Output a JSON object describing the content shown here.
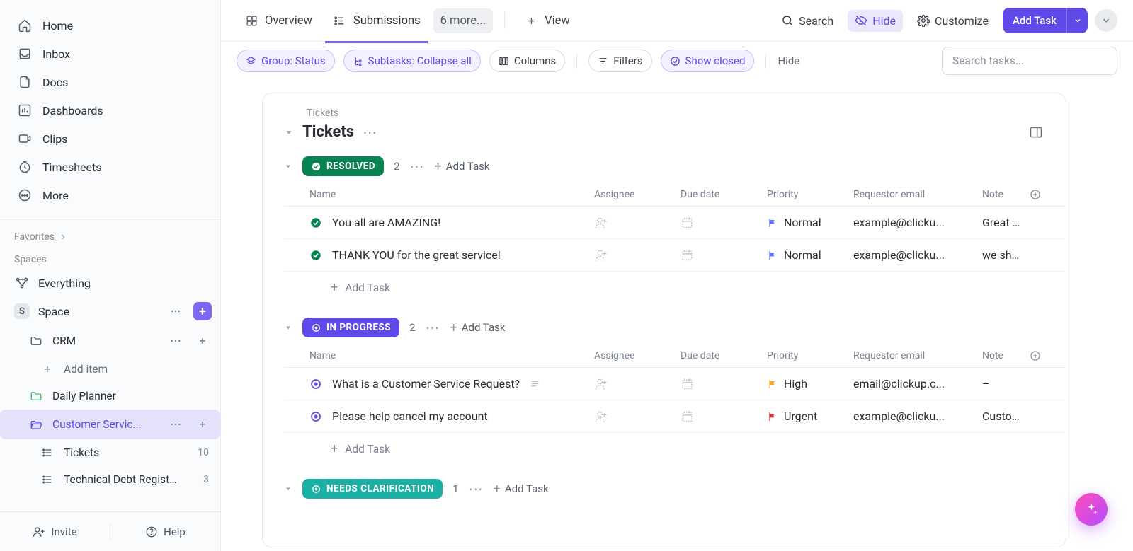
{
  "sidebar": {
    "nav": [
      {
        "label": "Home",
        "icon": "home"
      },
      {
        "label": "Inbox",
        "icon": "inbox"
      },
      {
        "label": "Docs",
        "icon": "doc"
      },
      {
        "label": "Dashboards",
        "icon": "dash"
      },
      {
        "label": "Clips",
        "icon": "clip"
      },
      {
        "label": "Timesheets",
        "icon": "time"
      },
      {
        "label": "More",
        "icon": "more"
      }
    ],
    "favorites_label": "Favorites",
    "spaces_label": "Spaces",
    "everything_label": "Everything",
    "space_label": "Space",
    "space_initial": "S",
    "tree": [
      {
        "label": "CRM",
        "type": "folder"
      },
      {
        "label": "Add item",
        "type": "add"
      },
      {
        "label": "Daily Planner",
        "type": "folder-green"
      },
      {
        "label": "Customer Servic...",
        "type": "folder-active"
      },
      {
        "label": "Tickets",
        "type": "list",
        "count": "10"
      },
      {
        "label": "Technical Debt Register",
        "type": "list",
        "count": "3"
      }
    ],
    "invite": "Invite",
    "help": "Help"
  },
  "topbar": {
    "tabs": [
      {
        "label": "Overview",
        "icon": "overview"
      },
      {
        "label": "Submissions",
        "icon": "list",
        "active": true
      },
      {
        "label": "6 more...",
        "pill": true
      },
      {
        "label": "View",
        "icon": "plus",
        "addview": true
      }
    ],
    "search": "Search",
    "hide": "Hide",
    "customize": "Customize",
    "add_task": "Add Task"
  },
  "filters": {
    "group": "Group: Status",
    "subtasks": "Subtasks: Collapse all",
    "columns": "Columns",
    "filters": "Filters",
    "show_closed": "Show closed",
    "hide": "Hide",
    "search_placeholder": "Search tasks..."
  },
  "list": {
    "breadcrumb": "Tickets",
    "title": "Tickets",
    "columns": {
      "name": "Name",
      "assignee": "Assignee",
      "due": "Due date",
      "priority": "Priority",
      "email": "Requestor email",
      "notes": "Note"
    },
    "add_task": "Add Task",
    "groups": [
      {
        "status": "RESOLVED",
        "pill": "pill-resolved",
        "count": "2",
        "status_icon": "check",
        "rows": [
          {
            "name": "You all are AMAZING!",
            "priority": "Normal",
            "flag": "#5f6fff",
            "email": "example@clicku...",
            "notes": "Great cus",
            "row_icon": "check"
          },
          {
            "name": "THANK YOU for the great service!",
            "priority": "Normal",
            "flag": "#5f6fff",
            "email": "example@clicku...",
            "notes": "we shoul",
            "row_icon": "check"
          }
        ]
      },
      {
        "status": "IN PROGRESS",
        "pill": "pill-inprogress",
        "count": "2",
        "status_icon": "ring",
        "rows": [
          {
            "name": "What is a Customer Service Request?",
            "priority": "High",
            "flag": "#f5a623",
            "email": "email@clickup.c...",
            "notes": "–",
            "row_icon": "ring-blue",
            "desc": true
          },
          {
            "name": "Please help cancel my account",
            "priority": "Urgent",
            "flag": "#d13438",
            "email": "example@clicku...",
            "notes": "Custome",
            "row_icon": "ring-blue"
          }
        ]
      },
      {
        "status": "NEEDS CLARIFICATION",
        "pill": "pill-needs",
        "count": "1",
        "status_icon": "ring",
        "header_only": true
      }
    ]
  }
}
